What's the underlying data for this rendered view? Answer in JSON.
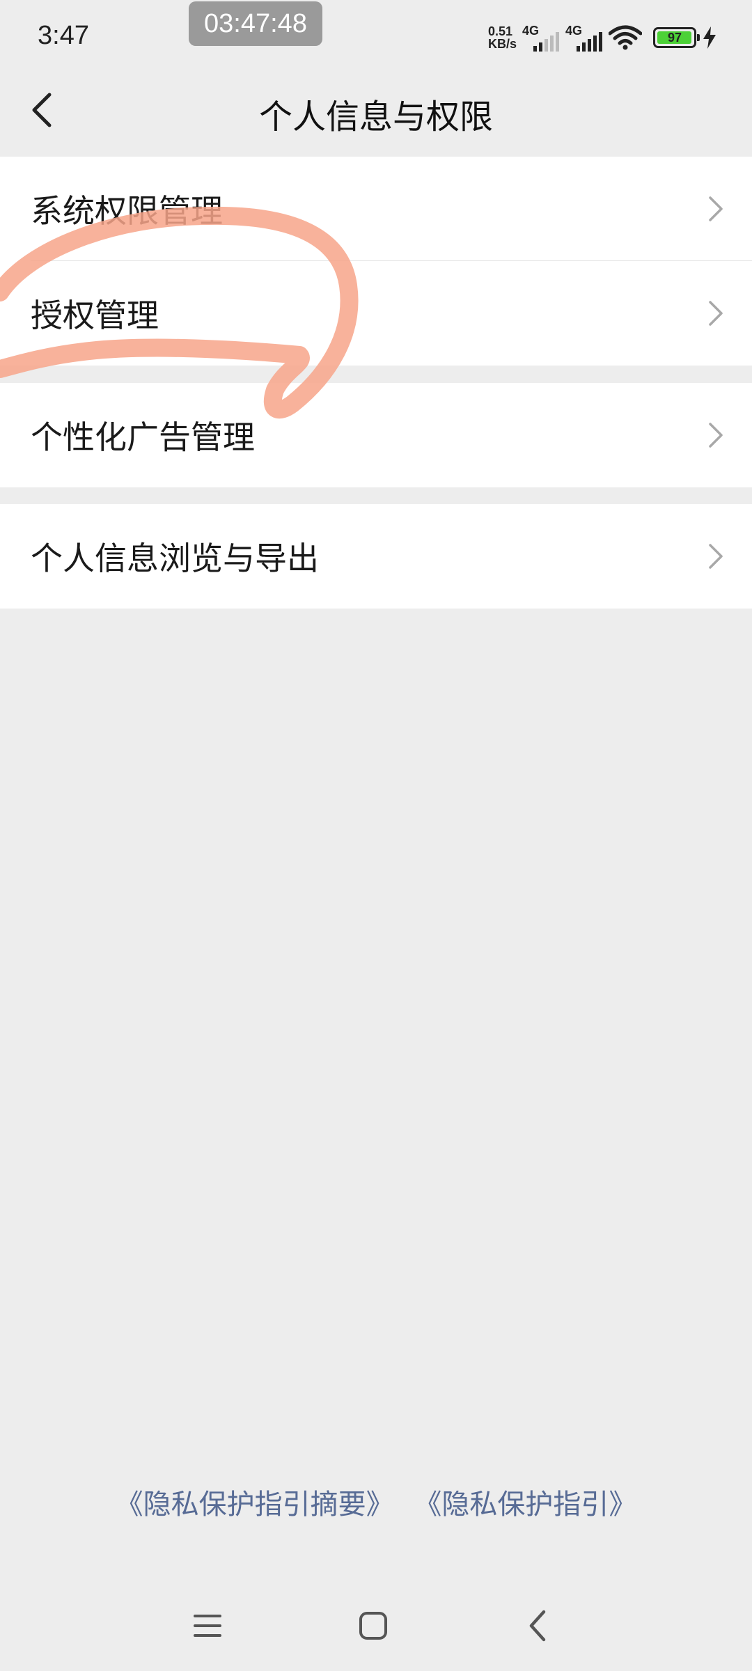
{
  "status_bar": {
    "time": "3:47",
    "recorder_time": "03:47:48",
    "net_speed_value": "0.51",
    "net_speed_unit": "KB/s",
    "sim1_tag": "4G",
    "sim2_tag": "4G",
    "battery_level": "97",
    "battery_fraction": 0.97,
    "icons": [
      "signal-icon",
      "wifi-icon",
      "battery-icon",
      "charging-icon"
    ]
  },
  "nav": {
    "title": "个人信息与权限",
    "back_icon": "chevron-left-icon"
  },
  "groups": [
    {
      "items": [
        {
          "label": "系统权限管理"
        },
        {
          "label": "授权管理"
        }
      ]
    },
    {
      "items": [
        {
          "label": "个性化广告管理"
        }
      ]
    },
    {
      "items": [
        {
          "label": "个人信息浏览与导出"
        }
      ]
    }
  ],
  "footer": {
    "link_summary": "《隐私保护指引摘要》",
    "link_full": "《隐私保护指引》"
  },
  "system_nav": {
    "icons": [
      "menu-icon",
      "home-icon",
      "back-icon"
    ]
  },
  "colors": {
    "background": "#ededed",
    "card": "#ffffff",
    "link": "#576b95",
    "highlight": "#f7a48a",
    "battery": "#4cd137"
  }
}
